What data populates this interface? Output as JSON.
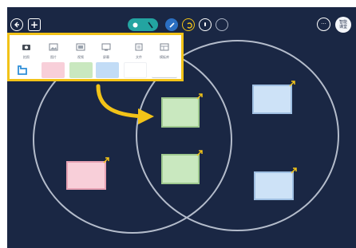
{
  "toolbar": {
    "back_label": "back",
    "add_label": "+",
    "more_label": "···",
    "badge_line1": "智能",
    "badge_line2": "课堂"
  },
  "sticker_panel": {
    "tools": [
      {
        "label": "拍照",
        "icon": "camera-icon"
      },
      {
        "label": "图片",
        "icon": "image-icon"
      },
      {
        "label": "视频",
        "icon": "video-icon"
      },
      {
        "label": "屏幕",
        "icon": "screen-icon"
      },
      {
        "label": "文件",
        "icon": "file-icon"
      },
      {
        "label": "模板库",
        "icon": "template-icon"
      }
    ],
    "swatch_colors": [
      "#f8cfd9",
      "#c9e8bf",
      "#c2dcf6",
      "#ffffff",
      "#ffffff"
    ]
  },
  "colors": {
    "canvas": "#1a2744",
    "panel_border": "#f2c318",
    "arrow": "#f2c318",
    "toolbar_teal": "#23a4a1",
    "circle_stroke": "#b4bccb"
  }
}
